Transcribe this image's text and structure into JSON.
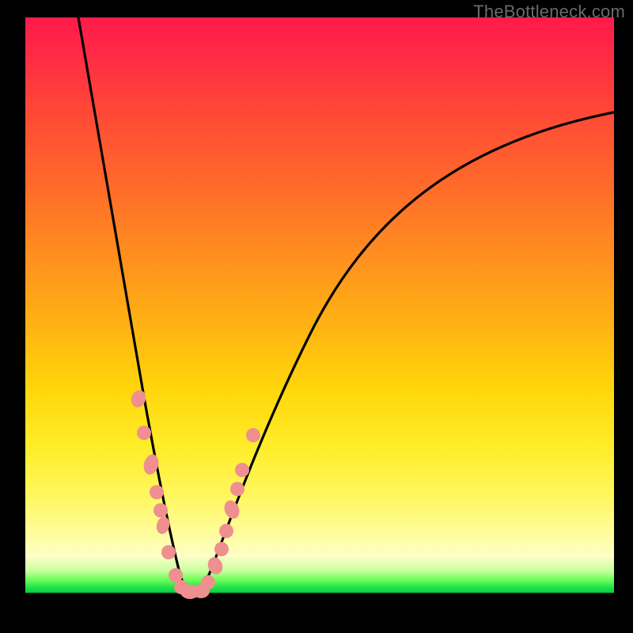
{
  "watermark": "TheBottleneck.com",
  "colors": {
    "background": "#000000",
    "gradient_top": "#ff1a4a",
    "gradient_mid1": "#ff8f1f",
    "gradient_mid2": "#ffed2a",
    "gradient_green": "#1fe24a",
    "curve_stroke": "#000000",
    "dot_fill": "#f08080",
    "watermark_text": "#6a6a6a"
  },
  "chart_data": {
    "type": "line",
    "title": "",
    "xlabel": "",
    "ylabel": "",
    "xlim": [
      0,
      100
    ],
    "ylim": [
      0,
      100
    ],
    "grid": false,
    "legend": false,
    "note": "V-shaped bottleneck curve. Values are estimated from pixel positions; y=0 is the green optimum band at the bottom, y=100 is the top edge.",
    "series": [
      {
        "name": "bottleneck-curve-left",
        "x": [
          9,
          12,
          15,
          18,
          20,
          22,
          23.5,
          25,
          26,
          27
        ],
        "y": [
          100,
          80,
          60,
          42,
          30,
          18,
          10,
          4,
          1,
          0
        ]
      },
      {
        "name": "bottleneck-curve-right",
        "x": [
          27,
          28.5,
          30,
          32,
          35,
          40,
          48,
          58,
          70,
          82,
          92,
          100
        ],
        "y": [
          0,
          1,
          4,
          10,
          20,
          34,
          50,
          63,
          73,
          79,
          82,
          84
        ]
      },
      {
        "name": "sample-dots",
        "type": "scatter",
        "x": [
          19.0,
          19.9,
          21.3,
          22.2,
          23.0,
          23.2,
          24.1,
          25.2,
          26.0,
          27.0,
          28.2,
          29.0,
          30.5,
          31.1,
          31.9,
          33.0,
          33.8,
          34.4,
          36.3
        ],
        "y": [
          36.0,
          30.5,
          22.0,
          17.0,
          14.0,
          11.5,
          7.0,
          3.0,
          1.0,
          0.5,
          0.5,
          1.0,
          4.5,
          7.0,
          10.5,
          14.5,
          18.0,
          21.0,
          27.0
        ]
      }
    ]
  }
}
